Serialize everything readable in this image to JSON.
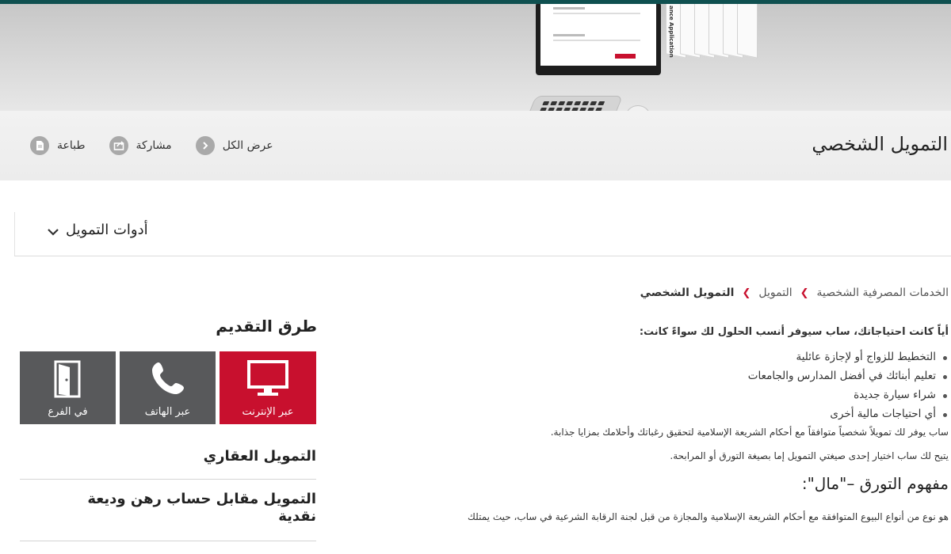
{
  "banner": {
    "hero_text": "ance Application"
  },
  "header": {
    "title": "التمويل الشخصي",
    "actions": [
      {
        "label": "طباعة",
        "icon": "print-icon"
      },
      {
        "label": "مشاركة",
        "icon": "share-icon"
      },
      {
        "label": "عرض الكل",
        "icon": "chevron-right-icon"
      }
    ]
  },
  "finance_tools": {
    "label": "أدوات التمويل",
    "icon": "chevron-down-icon"
  },
  "breadcrumb": {
    "items": [
      "الخدمات المصرفية الشخصية",
      "التمويل"
    ],
    "current": "التمويل الشخصي"
  },
  "article": {
    "intro": "أياً كانت احتياجاتك، ساب سيوفر أنسب الحلول لك سواءً كانت:",
    "bullets": [
      "التخطيط للزواج أو لإجازة عائلية",
      "تعليم أبنائك في أفضل المدارس والجامعات",
      "شراء سيارة جديدة",
      "أي احتياجات مالية أخرى"
    ],
    "p1": "ساب يوفر لك تمويلاً شخصياً متوافقاً مع أحكام الشريعة الإسلامية لتحقيق رغباتك وأحلامك بمزايا جذابة.",
    "p2": "يتيح لك ساب اختيار إحدى صيغتي التمويل إما بصيغة التورق أو المرابحة.",
    "heading": "مفهوم التورق –\"مال\":",
    "p3": "هو نوع من أنواع البيوع المتوافقة مع أحكام الشريعة الإسلامية والمجازة من قبل لجنة الرقابة الشرعية في ساب، حيث يمتلك"
  },
  "sidebar": {
    "apply_title": "طرق التقديم",
    "apply_methods": [
      {
        "label": "عبر الإنترنت",
        "icon": "monitor-icon"
      },
      {
        "label": "عبر الهاتف",
        "icon": "phone-icon"
      },
      {
        "label": "في الفرع",
        "icon": "door-icon"
      }
    ],
    "links": [
      {
        "label": "التمويل العقاري"
      },
      {
        "label": "التمويل مقابل حساب رهن وديعة نقدية"
      }
    ]
  },
  "colors": {
    "brand_red": "#c8102e",
    "tile_gray": "#58595b",
    "top_bar": "#0f5050"
  }
}
